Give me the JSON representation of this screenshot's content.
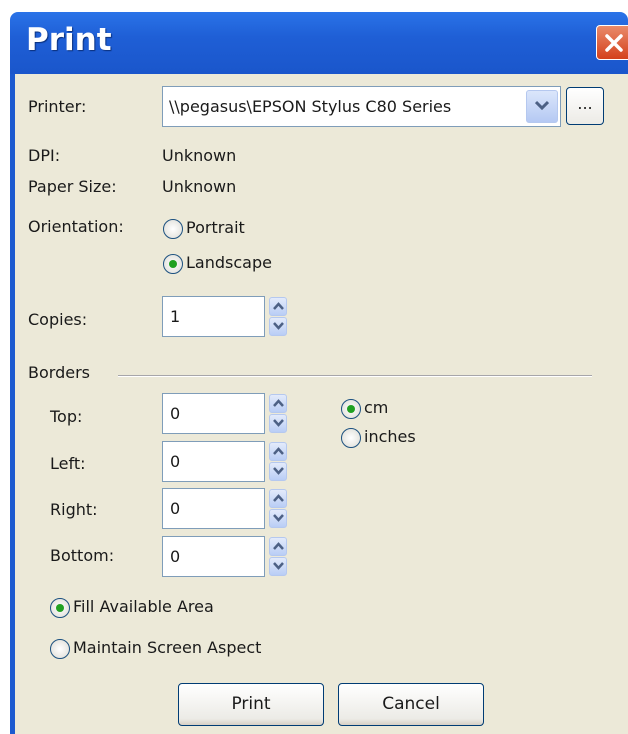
{
  "window": {
    "title": "Print"
  },
  "printer": {
    "label": "Printer:",
    "selected": "\\\\pegasus\\EPSON Stylus C80 Series",
    "browse_label": "..."
  },
  "info": {
    "dpi_label": "DPI:",
    "dpi_value": "Unknown",
    "paper_size_label": "Paper Size:",
    "paper_size_value": "Unknown"
  },
  "orientation": {
    "label": "Orientation:",
    "options": [
      "Portrait",
      "Landscape"
    ],
    "selected": "Landscape"
  },
  "copies": {
    "label": "Copies:",
    "value": "1"
  },
  "borders": {
    "label": "Borders",
    "fields": [
      {
        "label": "Top:",
        "value": "0"
      },
      {
        "label": "Left:",
        "value": "0"
      },
      {
        "label": "Right:",
        "value": "0"
      },
      {
        "label": "Bottom:",
        "value": "0"
      }
    ],
    "units": [
      "cm",
      "inches"
    ],
    "selected_unit": "cm"
  },
  "scaling": {
    "options": [
      "Fill Available Area",
      "Maintain Screen Aspect"
    ],
    "selected": "Fill Available Area"
  },
  "buttons": {
    "print": "Print",
    "cancel": "Cancel"
  },
  "colors": {
    "titlebar": "#1f5fd6",
    "close": "#d4411c",
    "dialog_bg": "#ece9d8",
    "radio_dot": "#21a121"
  }
}
